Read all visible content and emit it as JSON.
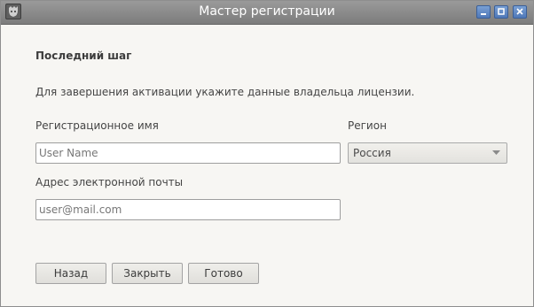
{
  "window": {
    "title": "Мастер регистрации",
    "icon": "app-logo-icon"
  },
  "content": {
    "heading": "Последний шаг",
    "description": "Для завершения активации укажите данные владельца лицензии."
  },
  "form": {
    "name_label": "Регистрационное имя",
    "name_placeholder": "User Name",
    "region_label": "Регион",
    "region_value": "Россия",
    "email_label": "Адрес электронной почты",
    "email_placeholder": "user@mail.com"
  },
  "buttons": {
    "back": "Назад",
    "close": "Закрыть",
    "done": "Готово"
  },
  "colors": {
    "titlebar": "#8a8a8a",
    "window_controls": "#5b84c4",
    "background": "#f7f6f3"
  }
}
